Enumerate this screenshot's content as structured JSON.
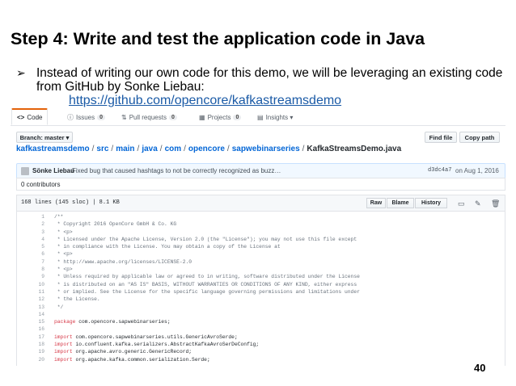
{
  "slide": {
    "title": "Step 4: Write and test the application code in Java",
    "bullet_marker": "➢",
    "bullet_text": "Instead of writing our own code for this demo, we will be leveraging an existing code from GitHub by Sonke Liebau:",
    "link": "https://github.com/opencore/kafkastreamsdemo",
    "page_number": "40"
  },
  "repo_tabs": [
    {
      "icon": "<>",
      "label": "Code"
    },
    {
      "icon": "ⓘ",
      "label": "Issues",
      "count": "0"
    },
    {
      "icon": "⇅",
      "label": "Pull requests",
      "count": "0"
    },
    {
      "icon": "▦",
      "label": "Projects",
      "count": "0"
    },
    {
      "icon": "▤",
      "label": "Insights ▾"
    }
  ],
  "toolbar": {
    "branch_label": "Branch: master ▾",
    "find_file": "Find file",
    "copy_path": "Copy path"
  },
  "breadcrumb": {
    "parts": [
      "kafkastreamsdemo",
      "src",
      "main",
      "java",
      "com",
      "opencore",
      "sapwebinarseries"
    ],
    "separator": "/",
    "file": "KafkaStreamsDemo.java"
  },
  "commit": {
    "author": "Sönke Liebau",
    "message": "Fixed bug that caused hashtags to not be correctly recognized as buzz…",
    "sha": "d3dc4a7",
    "date": "on Aug 1, 2016"
  },
  "contributors": "0 contributors",
  "file": {
    "info": "168 lines (145 sloc)  |  8.1 KB",
    "raw": "Raw",
    "blame": "Blame",
    "history": "History"
  },
  "code_lines": [
    {
      "n": "1",
      "t": "/**"
    },
    {
      "n": "2",
      "t": " * Copyright 2016 OpenCore GmbH & Co. KG"
    },
    {
      "n": "3",
      "t": " * <p>"
    },
    {
      "n": "4",
      "t": " * Licensed under the Apache License, Version 2.0 (the \"License\"); you may not use this file except"
    },
    {
      "n": "5",
      "t": " * in compliance with the License. You may obtain a copy of the License at"
    },
    {
      "n": "6",
      "t": " * <p>"
    },
    {
      "n": "7",
      "t": " * http://www.apache.org/licenses/LICENSE-2.0"
    },
    {
      "n": "8",
      "t": " * <p>"
    },
    {
      "n": "9",
      "t": " * Unless required by applicable law or agreed to in writing, software distributed under the License"
    },
    {
      "n": "10",
      "t": " * is distributed on an \"AS IS\" BASIS, WITHOUT WARRANTIES OR CONDITIONS OF ANY KIND, either express"
    },
    {
      "n": "11",
      "t": " * or implied. See the License for the specific language governing permissions and limitations under"
    },
    {
      "n": "12",
      "t": " * the License."
    },
    {
      "n": "13",
      "t": " */"
    },
    {
      "n": "14",
      "t": ""
    },
    {
      "n": "15",
      "kw": "package",
      "t": " com.opencore.sapwebinarseries;"
    },
    {
      "n": "16",
      "t": ""
    },
    {
      "n": "17",
      "kw": "import",
      "t": " com.opencore.sapwebinarseries.utils.GenericAvroSerde;"
    },
    {
      "n": "18",
      "kw": "import",
      "t": " io.confluent.kafka.serializers.AbstractKafkaAvroSerDeConfig;"
    },
    {
      "n": "19",
      "kw": "import",
      "t": " org.apache.avro.generic.GenericRecord;"
    },
    {
      "n": "20",
      "kw": "import",
      "t": " org.apache.kafka.common.serialization.Serde;"
    }
  ]
}
